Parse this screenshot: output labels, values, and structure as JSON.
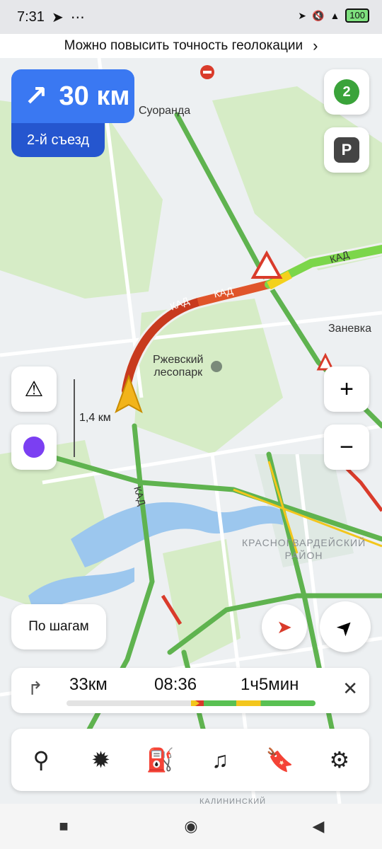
{
  "status_bar": {
    "time": "7:31",
    "battery": "100"
  },
  "banner": {
    "text": "Можно повысить точность геолокации"
  },
  "direction": {
    "distance": "30 км",
    "exit": "2-й съезд"
  },
  "map": {
    "labels": {
      "suoranda": "Суоранда",
      "zanevka": "Заневка",
      "rzhevsky": "Ржевский\nлесопарк",
      "district": "КРАСНОГВАРДЕЙСКИЙ\nРАЙОН",
      "kad_1": "КАД",
      "kad_2": "КАД",
      "kad_3": "КАД",
      "kad_4": "КАД",
      "kalininsky": "КАЛИНИНСКИЙ"
    },
    "traffic_level": "2",
    "scale": "1,4 км",
    "parking_label": "P"
  },
  "buttons": {
    "steps": "По шагам"
  },
  "route": {
    "distance": "33км",
    "arrival": "08:36",
    "duration": "1ч5мин"
  }
}
